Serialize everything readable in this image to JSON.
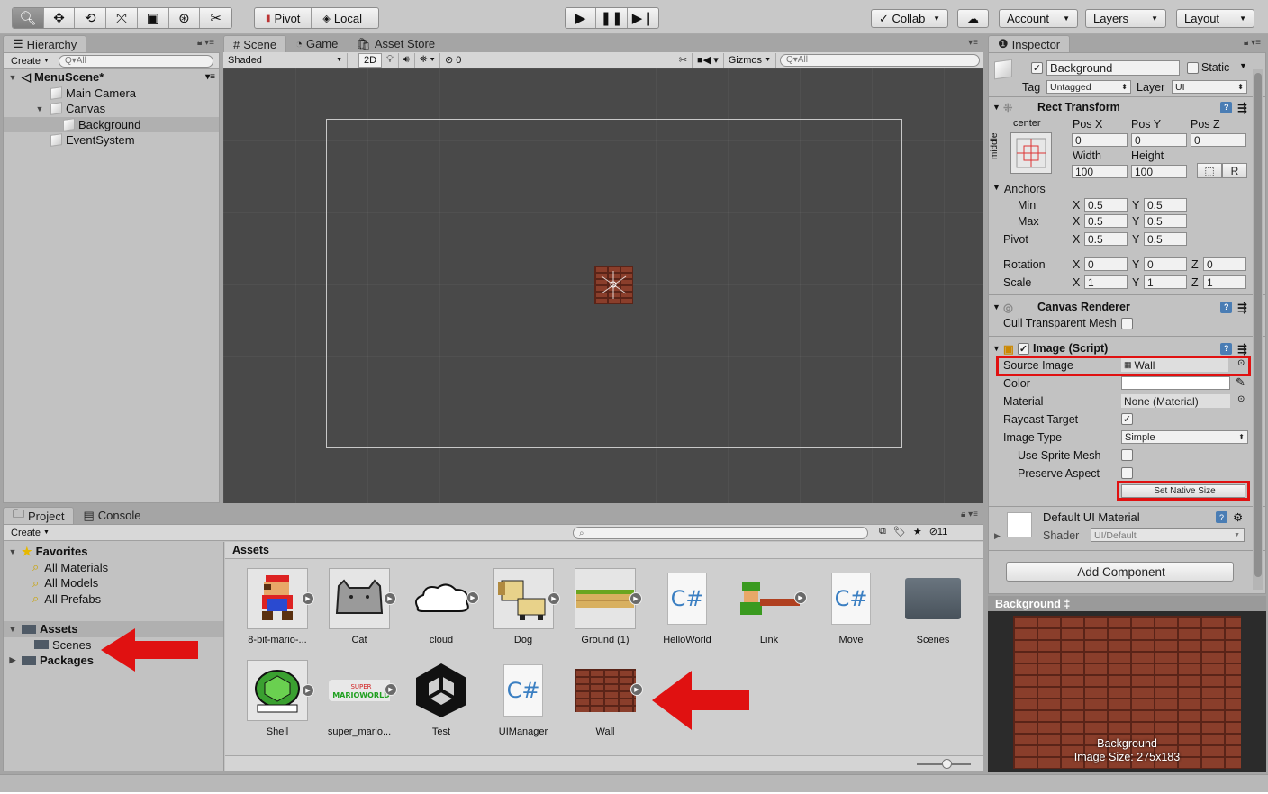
{
  "toolbar": {
    "tools": [
      "search-icon",
      "move-icon",
      "rotate-icon",
      "scale-icon",
      "rect-icon",
      "transform-icon",
      "custom-icon"
    ],
    "pivot": "Pivot",
    "local": "Local",
    "collab": "Collab",
    "account": "Account",
    "layers": "Layers",
    "layout": "Layout"
  },
  "hierarchy": {
    "tab": "Hierarchy",
    "create": "Create",
    "search_placeholder": "Q▾All",
    "scene": "MenuScene*",
    "items": [
      "Main Camera",
      "Canvas",
      "Background",
      "EventSystem"
    ]
  },
  "scene_tabs": {
    "scene": "Scene",
    "game": "Game",
    "asset_store": "Asset Store",
    "shaded": "Shaded",
    "mode_2d": "2D",
    "hidden_count": "0",
    "gizmos": "Gizmos",
    "search_placeholder": "Q▾All"
  },
  "inspector": {
    "tab": "Inspector",
    "object_name": "Background",
    "static": "Static",
    "tag_label": "Tag",
    "tag_value": "Untagged",
    "layer_label": "Layer",
    "layer_value": "UI",
    "rect_transform": {
      "title": "Rect Transform",
      "anchor_h": "center",
      "anchor_v": "middle",
      "pos_x_label": "Pos X",
      "pos_y_label": "Pos Y",
      "pos_z_label": "Pos Z",
      "pos_x": "0",
      "pos_y": "0",
      "pos_z": "0",
      "width_label": "Width",
      "height_label": "Height",
      "width": "100",
      "height": "100",
      "r_button": "R",
      "anchors_label": "Anchors",
      "min_label": "Min",
      "max_label": "Max",
      "pivot_label": "Pivot",
      "min_x": "0.5",
      "min_y": "0.5",
      "max_x": "0.5",
      "max_y": "0.5",
      "pivot_x": "0.5",
      "pivot_y": "0.5",
      "rotation_label": "Rotation",
      "scale_label": "Scale",
      "rot_x": "0",
      "rot_y": "0",
      "rot_z": "0",
      "scale_x": "1",
      "scale_y": "1",
      "scale_z": "1",
      "x": "X",
      "y": "Y",
      "z": "Z"
    },
    "canvas_renderer": {
      "title": "Canvas Renderer",
      "cull_label": "Cull Transparent Mesh"
    },
    "image_script": {
      "title": "Image (Script)",
      "source_image_label": "Source Image",
      "source_image_value": "Wall",
      "color_label": "Color",
      "material_label": "Material",
      "material_value": "None (Material)",
      "raycast_label": "Raycast Target",
      "image_type_label": "Image Type",
      "image_type_value": "Simple",
      "use_sprite_mesh_label": "Use Sprite Mesh",
      "preserve_aspect_label": "Preserve Aspect",
      "set_native_size": "Set Native Size"
    },
    "material": {
      "name": "Default UI Material",
      "shader_label": "Shader",
      "shader_value": "UI/Default"
    },
    "add_component": "Add Component",
    "preview_title": "Background ‡",
    "preview_caption_1": "Background",
    "preview_caption_2": "Image Size: 275x183"
  },
  "project": {
    "tab_project": "Project",
    "tab_console": "Console",
    "create": "Create",
    "hidden_count": "11",
    "favorites": "Favorites",
    "fav_items": [
      "All Materials",
      "All Models",
      "All Prefabs"
    ],
    "assets": "Assets",
    "scenes": "Scenes",
    "packages": "Packages",
    "assets_header": "Assets",
    "items_row1": [
      "8-bit-mario-...",
      "Cat",
      "cloud",
      "Dog",
      "Ground (1)",
      "HelloWorld",
      "Link",
      "Move",
      "Scenes"
    ],
    "items_row2": [
      "Shell",
      "super_mario...",
      "Test",
      "UIManager",
      "Wall"
    ],
    "csharp": "C#"
  },
  "colors": {
    "highlight": "#e01111",
    "panel": "#c2c2c2",
    "scene_bg": "#494949"
  }
}
